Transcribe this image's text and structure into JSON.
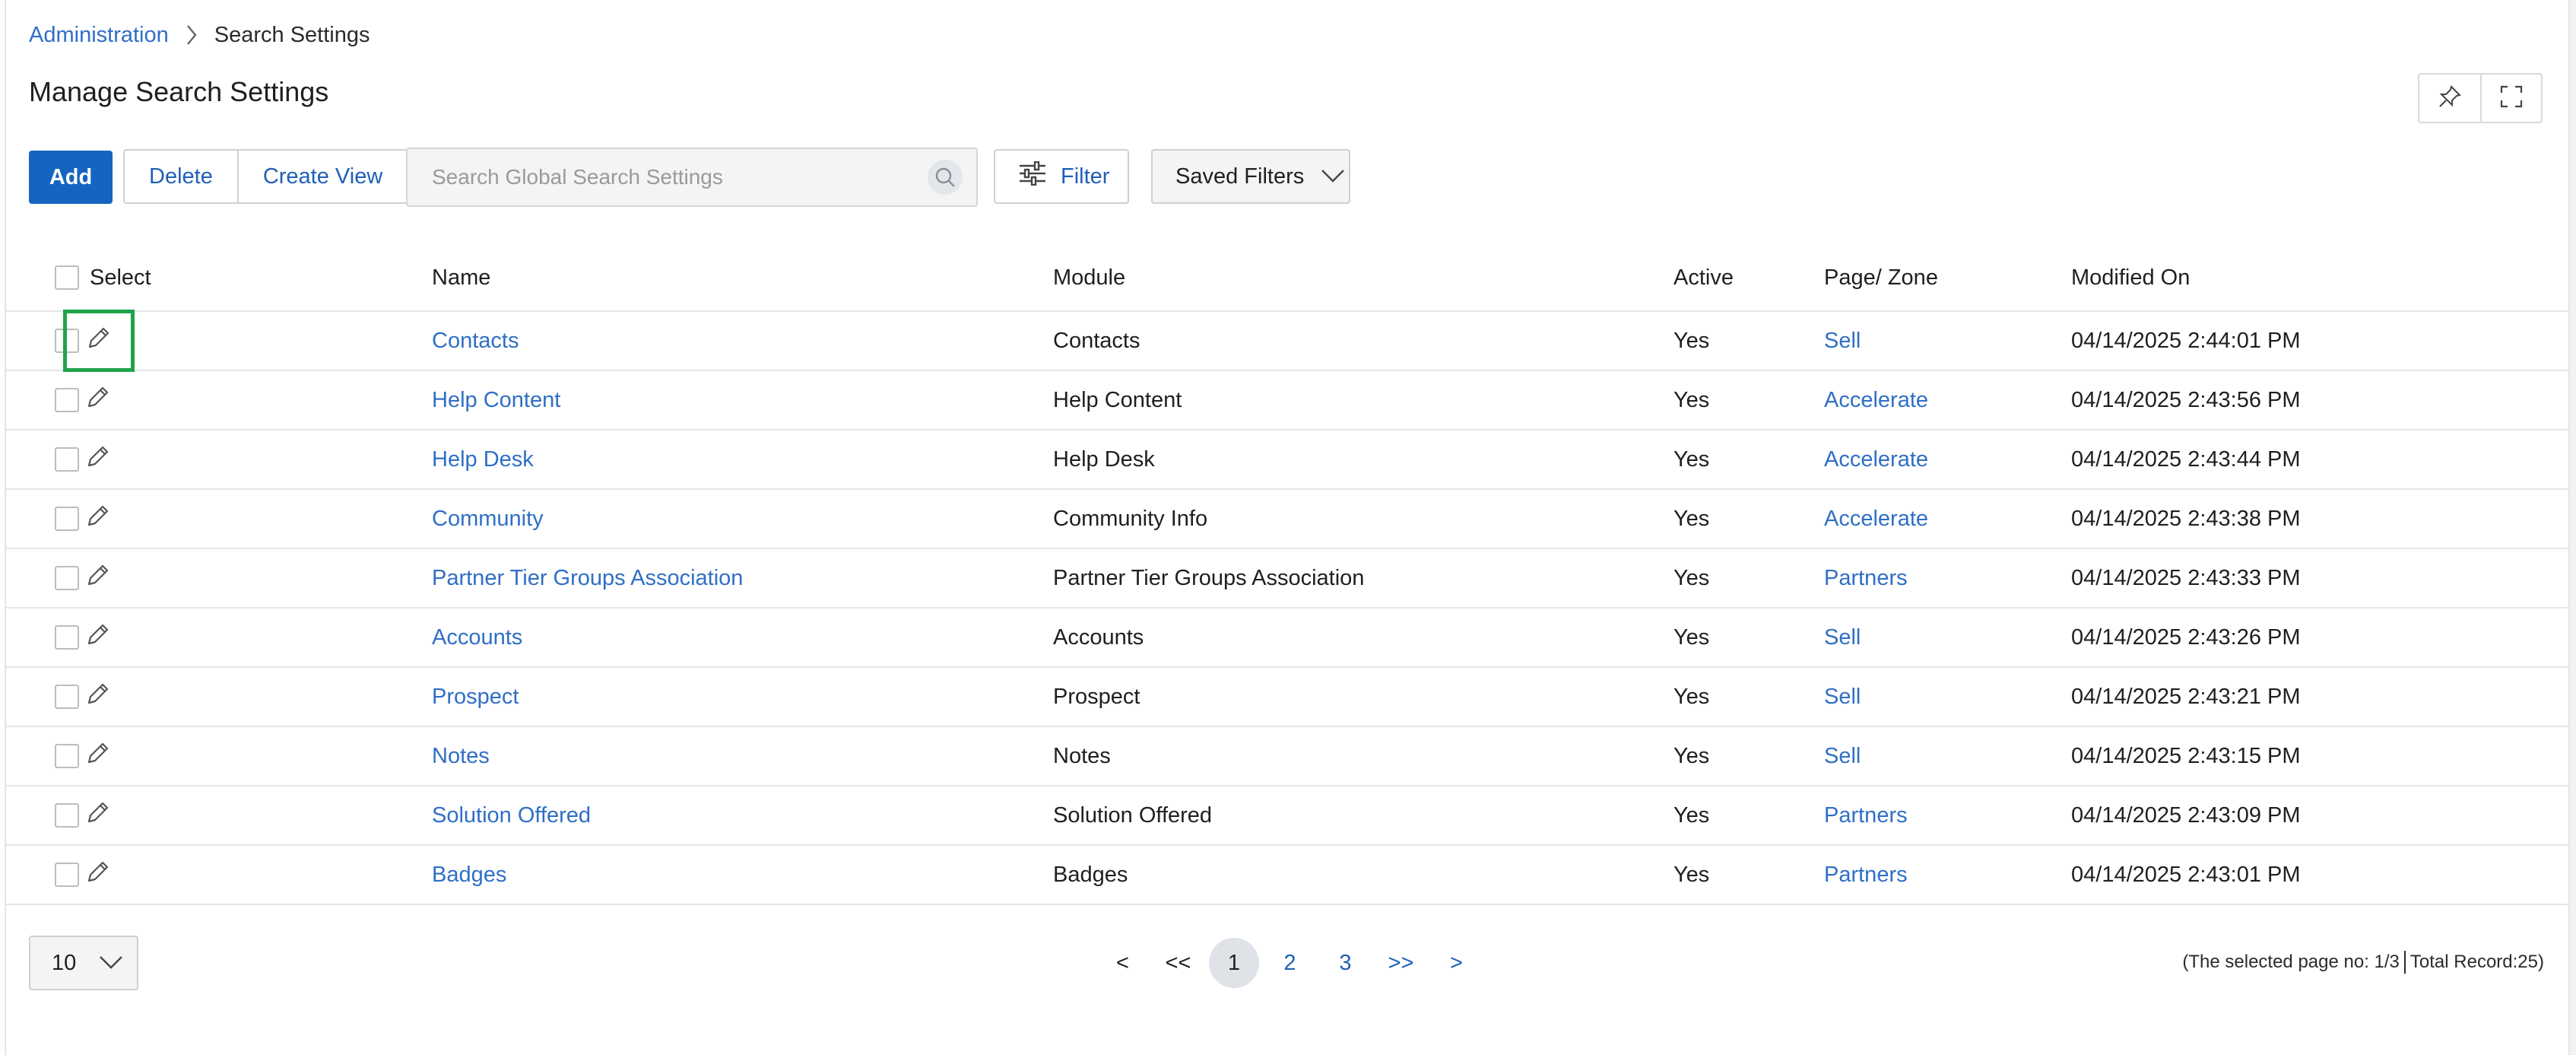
{
  "breadcrumb": {
    "parent": "Administration",
    "current": "Search Settings"
  },
  "page": {
    "title": "Manage Search Settings"
  },
  "icons": {
    "pin": "pin-icon",
    "fullscreen": "expand-icon",
    "search": "search-icon",
    "filter": "sliders-icon",
    "edit": "pencil-icon",
    "chevron": "chevron-down-icon",
    "breadcrumb_sep": "chevron-right-icon"
  },
  "toolbar": {
    "add_label": "Add",
    "delete_label": "Delete",
    "create_view_label": "Create View",
    "search_placeholder": "Search Global Search Settings",
    "filter_label": "Filter",
    "saved_filters_label": "Saved Filters"
  },
  "table": {
    "headers": {
      "select": "Select",
      "name": "Name",
      "module": "Module",
      "active": "Active",
      "page_zone": "Page/ Zone",
      "modified_on": "Modified On"
    },
    "rows": [
      {
        "name": "Contacts",
        "module": "Contacts",
        "active": "Yes",
        "page_zone": "Sell",
        "modified_on": "04/14/2025 2:44:01 PM"
      },
      {
        "name": "Help Content",
        "module": "Help Content",
        "active": "Yes",
        "page_zone": "Accelerate",
        "modified_on": "04/14/2025 2:43:56 PM"
      },
      {
        "name": "Help Desk",
        "module": "Help Desk",
        "active": "Yes",
        "page_zone": "Accelerate",
        "modified_on": "04/14/2025 2:43:44 PM"
      },
      {
        "name": "Community",
        "module": "Community Info",
        "active": "Yes",
        "page_zone": "Accelerate",
        "modified_on": "04/14/2025 2:43:38 PM"
      },
      {
        "name": "Partner Tier Groups Association",
        "module": "Partner Tier Groups Association",
        "active": "Yes",
        "page_zone": "Partners",
        "modified_on": "04/14/2025 2:43:33 PM"
      },
      {
        "name": "Accounts",
        "module": "Accounts",
        "active": "Yes",
        "page_zone": "Sell",
        "modified_on": "04/14/2025 2:43:26 PM"
      },
      {
        "name": "Prospect",
        "module": "Prospect",
        "active": "Yes",
        "page_zone": "Sell",
        "modified_on": "04/14/2025 2:43:21 PM"
      },
      {
        "name": "Notes",
        "module": "Notes",
        "active": "Yes",
        "page_zone": "Sell",
        "modified_on": "04/14/2025 2:43:15 PM"
      },
      {
        "name": "Solution Offered",
        "module": "Solution Offered",
        "active": "Yes",
        "page_zone": "Partners",
        "modified_on": "04/14/2025 2:43:09 PM"
      },
      {
        "name": "Badges",
        "module": "Badges",
        "active": "Yes",
        "page_zone": "Partners",
        "modified_on": "04/14/2025 2:43:01 PM"
      }
    ]
  },
  "pagination": {
    "page_size": "10",
    "prev": "<",
    "first": "<<",
    "pages": [
      "1",
      "2",
      "3"
    ],
    "last": ">>",
    "next": ">",
    "status_page": "(The selected page no: 1/3",
    "status_total": "Total Record:25)"
  },
  "colors": {
    "primary": "#1565c0",
    "link": "#2f6fc6",
    "highlight": "#1fa34a"
  }
}
